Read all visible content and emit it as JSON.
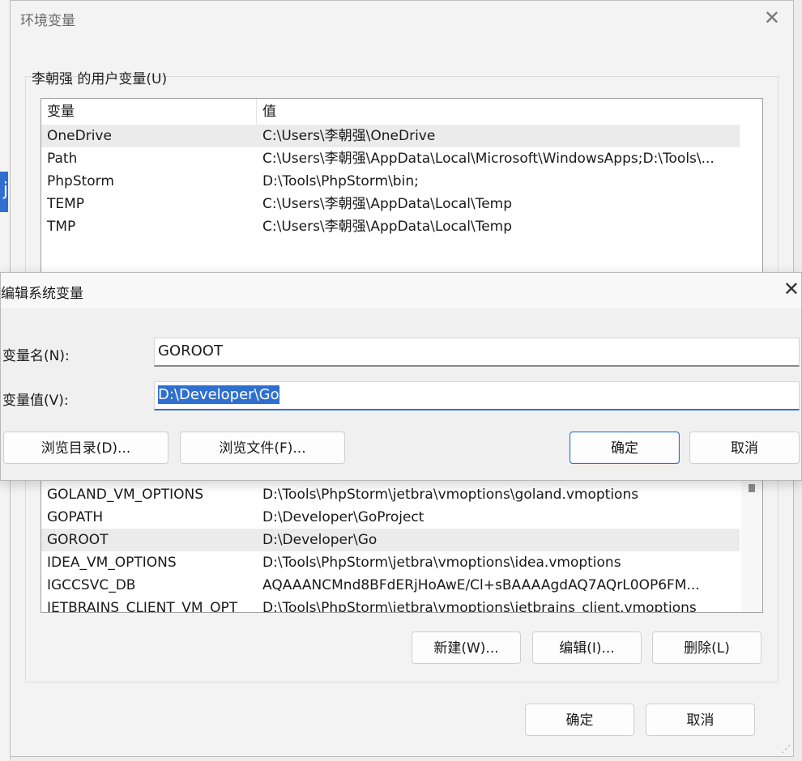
{
  "env_window": {
    "title": "环境变量",
    "user_group_label": "李朝强 的用户变量(U)",
    "columns": {
      "name": "变量",
      "value": "值"
    },
    "user_vars": [
      {
        "name": "OneDrive",
        "value": "C:\\Users\\李朝强\\OneDrive"
      },
      {
        "name": "Path",
        "value": "C:\\Users\\李朝强\\AppData\\Local\\Microsoft\\WindowsApps;D:\\Tools\\..."
      },
      {
        "name": "PhpStorm",
        "value": "D:\\Tools\\PhpStorm\\bin;"
      },
      {
        "name": "TEMP",
        "value": "C:\\Users\\李朝强\\AppData\\Local\\Temp"
      },
      {
        "name": "TMP",
        "value": "C:\\Users\\李朝强\\AppData\\Local\\Temp"
      }
    ],
    "system_vars": [
      {
        "name": "GOLAND_VM_OPTIONS",
        "value": "D:\\Tools\\PhpStorm\\jetbra\\vmoptions\\goland.vmoptions"
      },
      {
        "name": "GOPATH",
        "value": "D:\\Developer\\GoProject"
      },
      {
        "name": "GOROOT",
        "value": "D:\\Developer\\Go"
      },
      {
        "name": "IDEA_VM_OPTIONS",
        "value": "D:\\Tools\\PhpStorm\\jetbra\\vmoptions\\idea.vmoptions"
      },
      {
        "name": "IGCCSVC_DB",
        "value": "AQAAANCMnd8BFdERjHoAwE/Cl+sBAAAAgdAQ7AQrL0OP6FM..."
      },
      {
        "name": "JETBRAINS_CLIENT_VM_OPT",
        "value": "D:\\Tools\\PhpStorm\\jetbra\\vmoptions\\jetbrains_client.vmoptions"
      }
    ],
    "system_buttons": {
      "new": "新建(W)...",
      "edit": "编辑(I)...",
      "delete": "删除(L)"
    },
    "footer_buttons": {
      "ok": "确定",
      "cancel": "取消"
    },
    "close_glyph": "✕"
  },
  "edit_dialog": {
    "title": "编辑系统变量",
    "close_glyph": "✕",
    "name_label": "变量名(N):",
    "value_label": "变量值(V):",
    "name_value": "GOROOT",
    "value_value": "D:\\Developer\\Go",
    "buttons": {
      "browse_dir": "浏览目录(D)...",
      "browse_file": "浏览文件(F)...",
      "ok": "确定",
      "cancel": "取消"
    }
  },
  "background": {
    "edge_glyph": "j"
  },
  "colors": {
    "accent": "#2f6fd0",
    "selection_row": "#ebebeb"
  }
}
